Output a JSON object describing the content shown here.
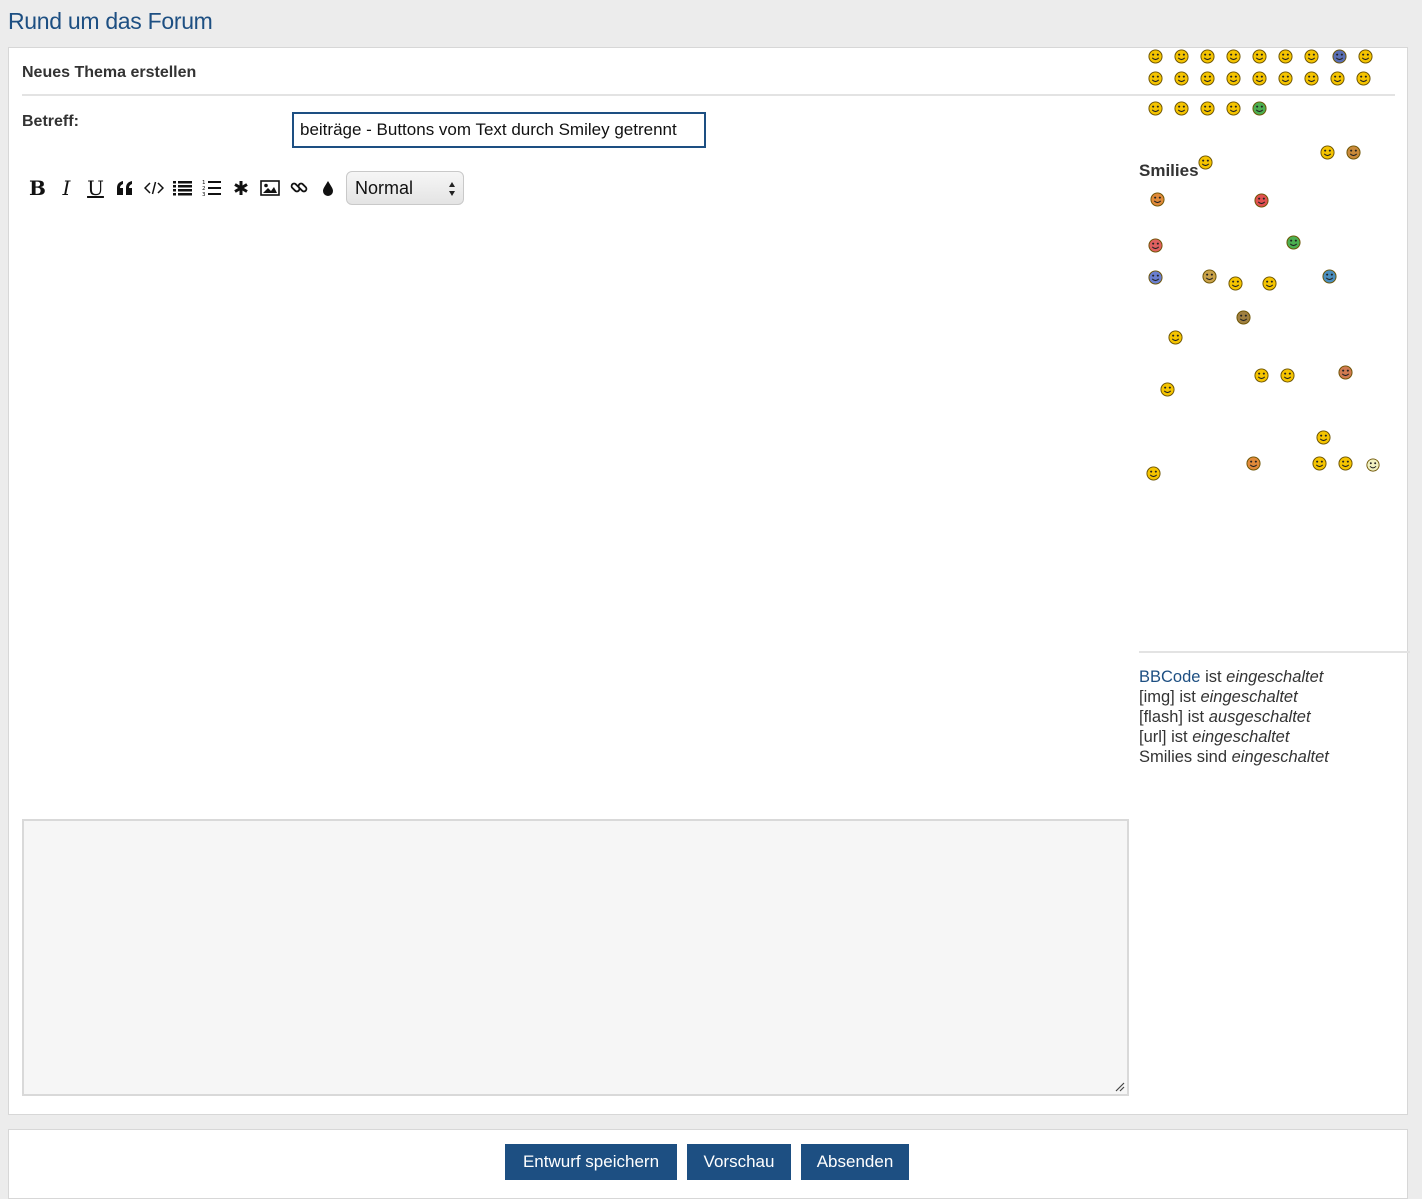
{
  "forum_title": "Rund um das Forum",
  "panel_title": "Neues Thema erstellen",
  "subject": {
    "label": "Betreff:",
    "value": "beiträge - Buttons vom Text durch Smiley getrennt"
  },
  "toolbar": {
    "buttons": [
      {
        "name": "bold",
        "icon": "bold-icon"
      },
      {
        "name": "italic",
        "icon": "italic-icon"
      },
      {
        "name": "underline",
        "icon": "underline-icon"
      },
      {
        "name": "quote",
        "icon": "quote-icon"
      },
      {
        "name": "code",
        "icon": "code-icon"
      },
      {
        "name": "list",
        "icon": "list-icon"
      },
      {
        "name": "numbered-list",
        "icon": "numbered-list-icon"
      },
      {
        "name": "list-item",
        "icon": "asterisk-icon"
      },
      {
        "name": "image",
        "icon": "image-icon"
      },
      {
        "name": "link",
        "icon": "link-icon"
      },
      {
        "name": "color",
        "icon": "color-drop-icon"
      }
    ],
    "font_size": "Normal"
  },
  "editor_text": "",
  "smilies": {
    "title": "Smilies"
  },
  "status": {
    "bbcode_link": "BBCode",
    "ist": "ist",
    "img_prefix": "[img]",
    "flash_prefix": "[flash]",
    "url_prefix": "[url]",
    "smilies_prefix": "Smilies sind",
    "on": "eingeschaltet",
    "off": "ausgeschaltet"
  },
  "buttons": {
    "save_draft": "Entwurf speichern",
    "preview": "Vorschau",
    "submit": "Absenden"
  },
  "colors": {
    "accent": "#1d4f82",
    "smiley_yellow": "#f5c400"
  }
}
